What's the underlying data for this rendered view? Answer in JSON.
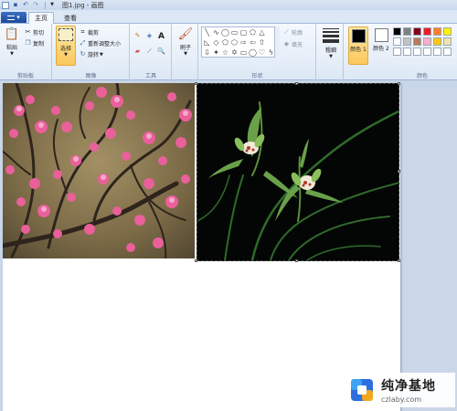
{
  "titlebar": {
    "title": "图1.jpg - 画图"
  },
  "tabs": {
    "file_label": "▾",
    "home": "主页",
    "view": "查看"
  },
  "clipboard": {
    "paste": "粘贴",
    "cut": "剪切",
    "copy": "复制",
    "group": "剪贴板"
  },
  "image": {
    "select": "选择",
    "crop": "裁剪",
    "resize": "重新调整大小",
    "rotate": "旋转",
    "group": "图像"
  },
  "tools": {
    "group": "工具"
  },
  "brushes": {
    "label": "刷子"
  },
  "shapes": {
    "outline": "轮廓",
    "fill": "填充",
    "group": "形状"
  },
  "size": {
    "label": "粗细"
  },
  "colors": {
    "color1": "颜色 1",
    "color2": "颜色 2",
    "group": "颜色",
    "color1_value": "#000000",
    "color2_value": "#ffffff",
    "palette": [
      "#000000",
      "#7f7f7f",
      "#880015",
      "#ed1c24",
      "#ff7f27",
      "#fff200",
      "#ffffff",
      "#c3c3c3",
      "#b97a57",
      "#ffaec9",
      "#ffc90e",
      "#efe4b0"
    ]
  },
  "watermark": {
    "name": "纯净基地",
    "url": "czlaby.com"
  }
}
